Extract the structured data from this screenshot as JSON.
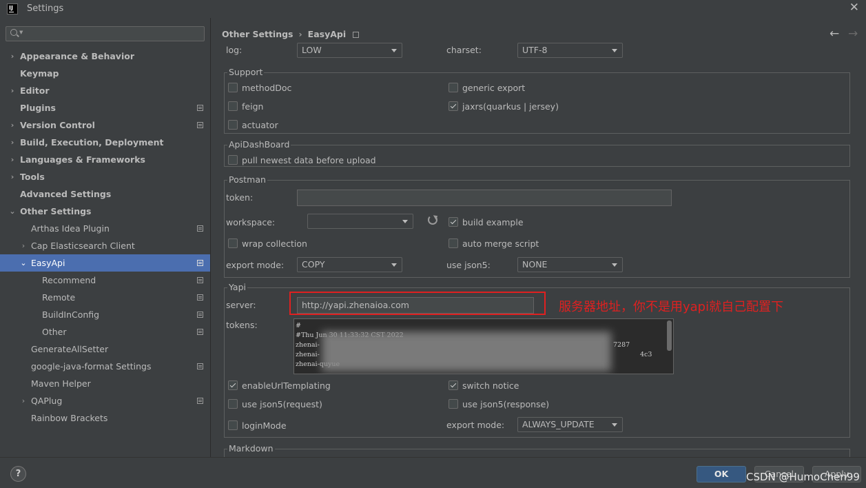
{
  "window": {
    "title": "Settings",
    "app_icon_text": "IJ"
  },
  "search": {
    "placeholder": ""
  },
  "sidebar": {
    "items": [
      {
        "label": "Appearance & Behavior",
        "bold": true,
        "chevron": "›",
        "indent": 0,
        "cfg": false,
        "selected": false
      },
      {
        "label": "Keymap",
        "bold": true,
        "chevron": "",
        "indent": 0,
        "cfg": false,
        "selected": false
      },
      {
        "label": "Editor",
        "bold": true,
        "chevron": "›",
        "indent": 0,
        "cfg": false,
        "selected": false
      },
      {
        "label": "Plugins",
        "bold": true,
        "chevron": "",
        "indent": 0,
        "cfg": true,
        "selected": false
      },
      {
        "label": "Version Control",
        "bold": true,
        "chevron": "›",
        "indent": 0,
        "cfg": true,
        "selected": false
      },
      {
        "label": "Build, Execution, Deployment",
        "bold": true,
        "chevron": "›",
        "indent": 0,
        "cfg": false,
        "selected": false
      },
      {
        "label": "Languages & Frameworks",
        "bold": true,
        "chevron": "›",
        "indent": 0,
        "cfg": false,
        "selected": false
      },
      {
        "label": "Tools",
        "bold": true,
        "chevron": "›",
        "indent": 0,
        "cfg": false,
        "selected": false
      },
      {
        "label": "Advanced Settings",
        "bold": true,
        "chevron": "",
        "indent": 0,
        "cfg": false,
        "selected": false
      },
      {
        "label": "Other Settings",
        "bold": true,
        "chevron": "⌄",
        "indent": 0,
        "cfg": false,
        "selected": false
      },
      {
        "label": "Arthas Idea Plugin",
        "bold": false,
        "chevron": "",
        "indent": 1,
        "cfg": true,
        "selected": false
      },
      {
        "label": "Cap Elasticsearch Client",
        "bold": false,
        "chevron": "›",
        "indent": 1,
        "cfg": false,
        "selected": false
      },
      {
        "label": "EasyApi",
        "bold": false,
        "chevron": "⌄",
        "indent": 1,
        "cfg": true,
        "selected": true
      },
      {
        "label": "Recommend",
        "bold": false,
        "chevron": "",
        "indent": 2,
        "cfg": true,
        "selected": false
      },
      {
        "label": "Remote",
        "bold": false,
        "chevron": "",
        "indent": 2,
        "cfg": true,
        "selected": false
      },
      {
        "label": "BuildInConfig",
        "bold": false,
        "chevron": "",
        "indent": 2,
        "cfg": true,
        "selected": false
      },
      {
        "label": "Other",
        "bold": false,
        "chevron": "",
        "indent": 2,
        "cfg": true,
        "selected": false
      },
      {
        "label": "GenerateAllSetter",
        "bold": false,
        "chevron": "",
        "indent": 1,
        "cfg": false,
        "selected": false
      },
      {
        "label": "google-java-format Settings",
        "bold": false,
        "chevron": "",
        "indent": 1,
        "cfg": true,
        "selected": false
      },
      {
        "label": "Maven Helper",
        "bold": false,
        "chevron": "",
        "indent": 1,
        "cfg": false,
        "selected": false
      },
      {
        "label": "QAPlug",
        "bold": false,
        "chevron": "›",
        "indent": 1,
        "cfg": true,
        "selected": false
      },
      {
        "label": "Rainbow Brackets",
        "bold": false,
        "chevron": "",
        "indent": 1,
        "cfg": false,
        "selected": false
      }
    ]
  },
  "breadcrumb": {
    "parent": "Other Settings",
    "sep": "›",
    "current": "EasyApi"
  },
  "nav": {
    "back": "←",
    "forward": "→"
  },
  "top": {
    "log_label": "log:",
    "log_value": "LOW",
    "charset_label": "charset:",
    "charset_value": "UTF-8"
  },
  "support": {
    "title": "Support",
    "methodDoc": "methodDoc",
    "methodDoc_checked": false,
    "generic_export": "generic export",
    "generic_export_checked": false,
    "feign": "feign",
    "feign_checked": false,
    "jaxrs": "jaxrs(quarkus | jersey)",
    "jaxrs_checked": true,
    "actuator": "actuator",
    "actuator_checked": false
  },
  "apidashboard": {
    "title": "ApiDashBoard",
    "pull": "pull newest data before upload",
    "pull_checked": false
  },
  "postman": {
    "title": "Postman",
    "token_label": "token:",
    "token_value": "",
    "workspace_label": "workspace:",
    "workspace_value": "",
    "build_example": "build example",
    "build_example_checked": true,
    "wrap_collection": "wrap collection",
    "wrap_collection_checked": false,
    "auto_merge": "auto merge script",
    "auto_merge_checked": false,
    "export_mode_label": "export mode:",
    "export_mode_value": "COPY",
    "use_json5_label": "use json5:",
    "use_json5_value": "NONE"
  },
  "yapi": {
    "title": "Yapi",
    "server_label": "server:",
    "server_value": "http://yapi.zhenaioa.com",
    "annotation": "服务器地址，你不是用yapi就自己配置下",
    "tokens_label": "tokens:",
    "token_lines": [
      "#",
      "#Thu Jun 30 11:33:32 CST 2022",
      "zhenai-",
      "zhenai-",
      "zhenai-quyue"
    ],
    "token_tail": [
      "7287",
      "4c3"
    ],
    "enableUrl": "enableUrlTemplating",
    "enableUrl_checked": true,
    "switch_notice": "switch notice",
    "switch_notice_checked": true,
    "json5_req": "use json5(request)",
    "json5_req_checked": false,
    "json5_resp": "use json5(response)",
    "json5_resp_checked": false,
    "loginMode": "loginMode",
    "loginMode_checked": false,
    "export_mode_label": "export mode:",
    "export_mode_value": "ALWAYS_UPDATE"
  },
  "markdown": {
    "title": "Markdown"
  },
  "footer": {
    "help": "?",
    "ok": "OK",
    "cancel": "Cancel",
    "apply": "Apply",
    "watermark": "CSDN @HumoChen99"
  }
}
